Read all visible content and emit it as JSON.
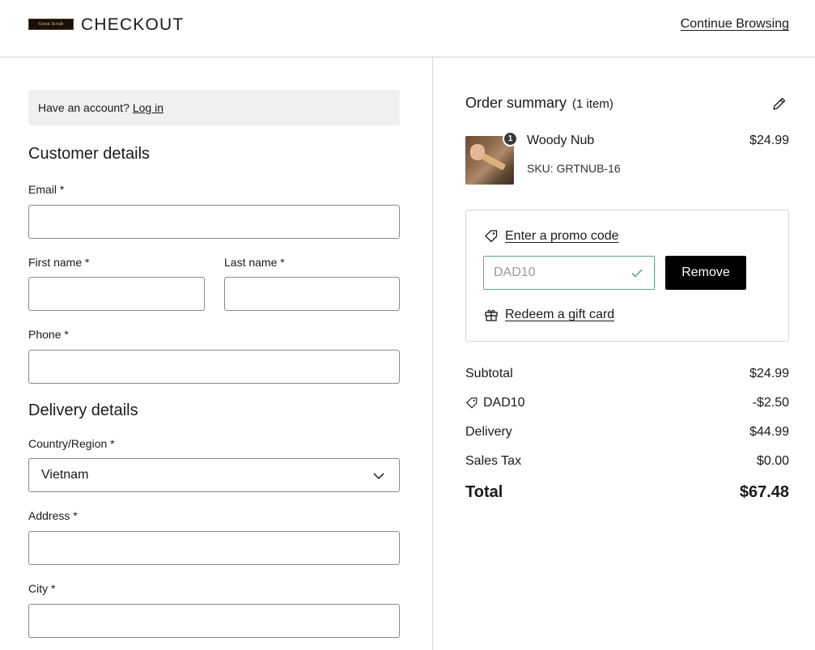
{
  "header": {
    "logo_text": "Great Scrub",
    "title": "CHECKOUT",
    "continue_label": "Continue Browsing"
  },
  "account": {
    "prompt": "Have an account?",
    "login_label": "Log in"
  },
  "customer": {
    "section_title": "Customer details",
    "email_label": "Email *",
    "first_name_label": "First name *",
    "last_name_label": "Last name *",
    "phone_label": "Phone *"
  },
  "delivery": {
    "section_title": "Delivery details",
    "country_label": "Country/Region *",
    "country_value": "Vietnam",
    "address_label": "Address *",
    "city_label": "City *"
  },
  "summary": {
    "title": "Order summary",
    "count": "(1 item)",
    "item": {
      "quantity": "1",
      "name": "Woody Nub",
      "sku": "SKU: GRTNUB-16",
      "price": "$24.99"
    },
    "promo": {
      "link_label": "Enter a promo code",
      "code_value": "DAD10",
      "remove_label": "Remove",
      "gift_label": "Redeem a gift card"
    },
    "lines": {
      "subtotal_label": "Subtotal",
      "subtotal_value": "$24.99",
      "discount_label": "DAD10",
      "discount_value": "-$2.50",
      "delivery_label": "Delivery",
      "delivery_value": "$44.99",
      "tax_label": "Sales Tax",
      "tax_value": "$0.00",
      "total_label": "Total",
      "total_value": "$67.48"
    }
  },
  "colors": {
    "accent_green": "#5ea883",
    "button_black": "#000000",
    "account_bg": "#f0f0f0"
  }
}
